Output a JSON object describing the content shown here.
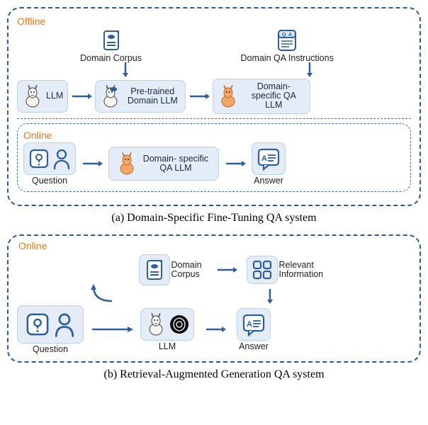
{
  "panelA": {
    "offline_label": "Offline",
    "online_label": "Online",
    "domain_corpus": "Domain Corpus",
    "domain_qa_instr": "Domain QA Instructions",
    "llm": "LLM",
    "pretrained": "Pre-trained Domain LLM",
    "domain_specific": "Domain- specific QA LLM",
    "question": "Question",
    "answer": "Answer",
    "caption": "(a) Domain-Specific Fine-Tuning QA system"
  },
  "panelB": {
    "online_label": "Online",
    "domain_corpus": "Domain Corpus",
    "relevant_info": "Relevant Information",
    "question": "Question",
    "llm": "LLM",
    "answer": "Answer",
    "caption": "(b) Retrieval-Augmented Generation QA system"
  }
}
